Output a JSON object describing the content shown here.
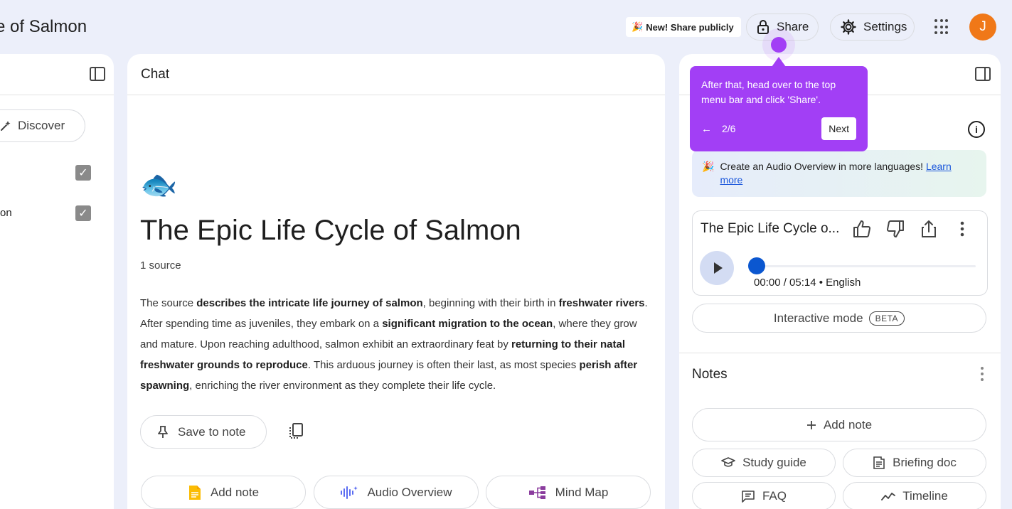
{
  "header": {
    "notebook_title": "e of Salmon",
    "new_badge_emoji": "🎉",
    "new_badge_text": "New! Share publicly",
    "share_label": "Share",
    "settings_label": "Settings",
    "avatar_initial": "J"
  },
  "sources_panel": {
    "discover_label": "Discover",
    "source_partial_text": "on"
  },
  "chat": {
    "header_title": "Chat",
    "notebook_emoji": "🐟",
    "title": "The Epic Life Cycle of Salmon",
    "source_count": "1 source",
    "summary": [
      {
        "t": "The source ",
        "b": false
      },
      {
        "t": "describes the intricate life journey of salmon",
        "b": true
      },
      {
        "t": ", beginning with their birth in ",
        "b": false
      },
      {
        "t": "freshwater rivers",
        "b": true
      },
      {
        "t": ". After spending time as juveniles, they embark on a ",
        "b": false
      },
      {
        "t": "significant migration to the ocean",
        "b": true
      },
      {
        "t": ", where they grow and mature. Upon reaching adulthood, salmon exhibit an extraordinary feat by ",
        "b": false
      },
      {
        "t": "returning to their natal freshwater grounds to reproduce",
        "b": true
      },
      {
        "t": ". This arduous journey is often their last, as most species ",
        "b": false
      },
      {
        "t": "perish after spawning",
        "b": true
      },
      {
        "t": ", enriching the river environment as they complete their life cycle.",
        "b": false
      }
    ],
    "save_to_note_label": "Save to note",
    "add_note_label": "Add note",
    "audio_overview_label": "Audio Overview",
    "mind_map_label": "Mind Map"
  },
  "tooltip": {
    "text": "After that, head over to the top menu bar and click 'Share'.",
    "back_glyph": "←",
    "step": "2/6",
    "next_label": "Next"
  },
  "studio": {
    "banner_emoji": "🎉",
    "banner_text": "Create an Audio Overview in more languages! ",
    "banner_link": "Learn more",
    "audio_title": "The Epic Life Cycle o...",
    "audio_time": "00:00 / 05:14 • English",
    "audio_progress": 0.0,
    "interactive_label": "Interactive mode",
    "beta_label": "BETA",
    "notes_title": "Notes",
    "add_note_label": "Add note",
    "study_guide_label": "Study guide",
    "briefing_doc_label": "Briefing doc",
    "faq_label": "FAQ",
    "timeline_label": "Timeline"
  },
  "colors": {
    "background": "#eceffa",
    "tooltip": "#a23ff5",
    "avatar": "#f07818",
    "progress_knob": "#0b57d0"
  }
}
